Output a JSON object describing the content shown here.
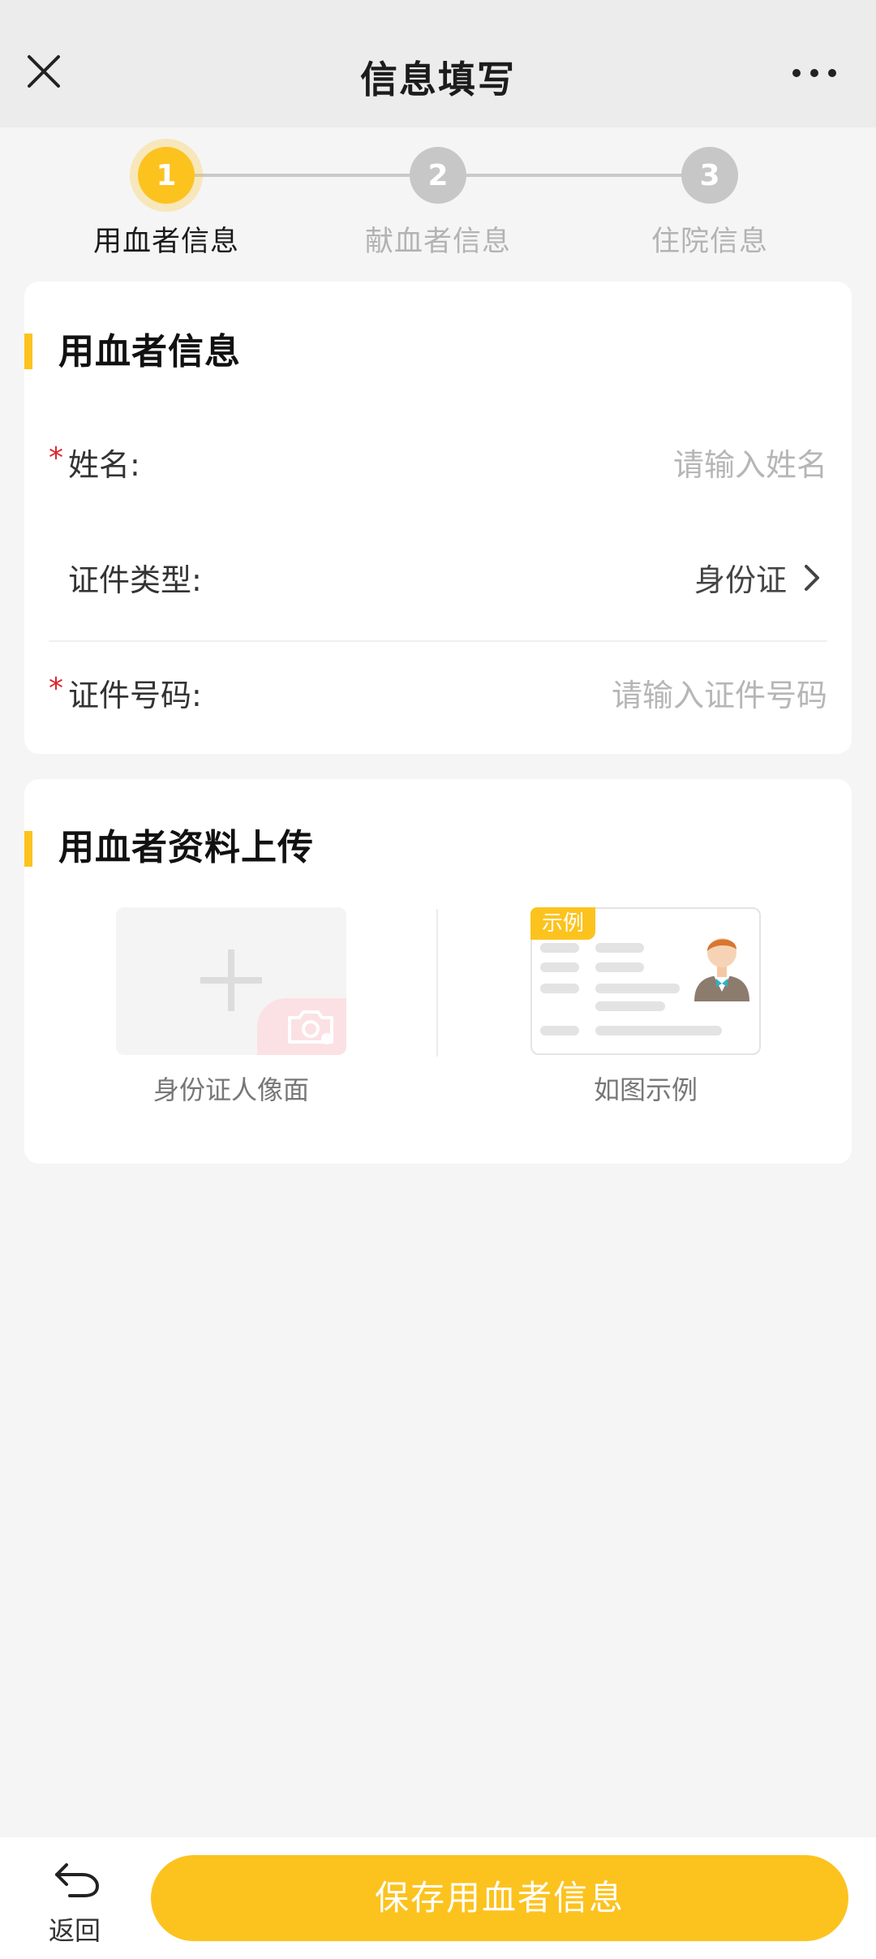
{
  "header": {
    "title": "信息填写"
  },
  "stepper": {
    "steps": [
      {
        "number": "1",
        "label": "用血者信息",
        "active": true
      },
      {
        "number": "2",
        "label": "献血者信息",
        "active": false
      },
      {
        "number": "3",
        "label": "住院信息",
        "active": false
      }
    ]
  },
  "recipient_section": {
    "title": "用血者信息",
    "fields": [
      {
        "label": "姓名:",
        "required": true,
        "placeholder": "请输入姓名"
      },
      {
        "label": "证件类型:",
        "required": false,
        "value": "身份证"
      },
      {
        "label": "证件号码:",
        "required": true,
        "placeholder": "请输入证件号码"
      }
    ]
  },
  "upload_section": {
    "title": "用血者资料上传",
    "upload_caption": "身份证人像面",
    "sample_tag": "示例",
    "sample_caption": "如图示例"
  },
  "bottom_bar": {
    "back_label": "返回",
    "save_label": "保存用血者信息"
  },
  "colors": {
    "accent": "#fcc31f",
    "required": "#d8272e",
    "placeholder": "#b6b6b6"
  }
}
